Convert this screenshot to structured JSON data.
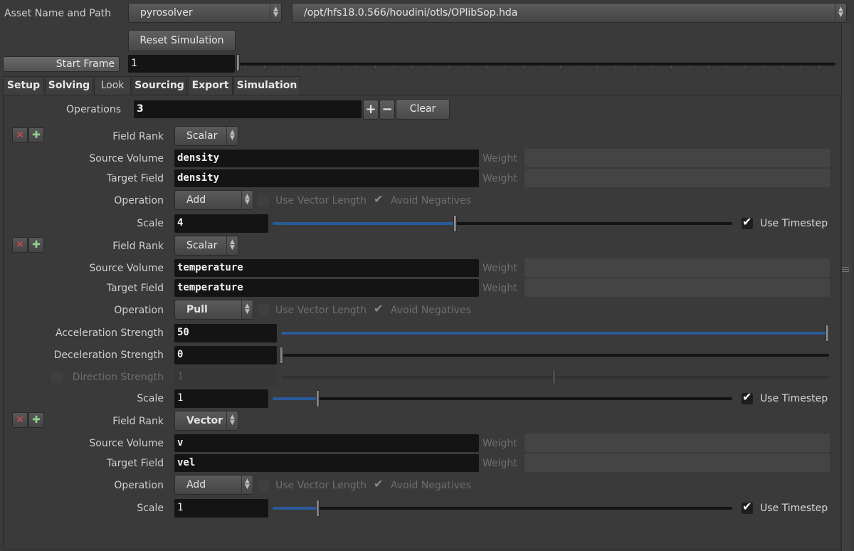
{
  "header": {
    "asset_label": "Asset Name and Path",
    "asset_name": "pyrosolver",
    "asset_path": "/opt/hfs18.0.566/houdini/otls/OPlibSop.hda",
    "reset_label": "Reset Simulation",
    "start_frame_label": "Start Frame",
    "start_frame_value": "1"
  },
  "tabs": [
    "Setup",
    "Solving",
    "Look",
    "Sourcing",
    "Export",
    "Simulation"
  ],
  "active_tab": "Sourcing",
  "operations": {
    "label": "Operations",
    "count": "3",
    "plus_label": "+",
    "minus_label": "−",
    "clear_label": "Clear"
  },
  "labels": {
    "field_rank": "Field Rank",
    "source_volume": "Source Volume",
    "target_field": "Target Field",
    "operation": "Operation",
    "scale": "Scale",
    "weight": "Weight",
    "use_vector_length": "Use Vector Length",
    "avoid_negatives": "Avoid Negatives",
    "use_timestep": "Use Timestep",
    "acceleration_strength": "Acceleration Strength",
    "deceleration_strength": "Deceleration Strength",
    "direction_strength": "Direction Strength"
  },
  "sources": [
    {
      "field_rank": "Scalar",
      "source_volume": "density",
      "target_field": "density",
      "operation": "Add",
      "scale": "4",
      "scale_fraction": 0.4,
      "use_vector_length": false,
      "avoid_negatives": true,
      "use_timestep": true
    },
    {
      "field_rank": "Scalar",
      "source_volume": "temperature",
      "target_field": "temperature",
      "operation": "Pull",
      "acceleration_strength": "50",
      "acceleration_fraction": 1.0,
      "deceleration_strength": "0",
      "deceleration_fraction": 0.0,
      "direction_strength": "1",
      "direction_fraction": 0.5,
      "scale": "1",
      "scale_fraction": 0.1,
      "use_vector_length": false,
      "avoid_negatives": true,
      "use_timestep": true
    },
    {
      "field_rank": "Vector",
      "source_volume": "v",
      "target_field": "vel",
      "operation": "Add",
      "scale": "1",
      "scale_fraction": 0.1,
      "use_vector_length": false,
      "avoid_negatives": true,
      "use_timestep": true
    }
  ],
  "icons": {
    "remove": "remove-x-icon",
    "insert": "insert-plus-icon",
    "combo_arrows": "up-down-arrows-icon",
    "checkmark": "checkmark-icon"
  },
  "colors": {
    "background": "#3a3a3a",
    "field": "#141414",
    "slider_fill": "#2a5a9a",
    "remove_icon": "#e04848",
    "insert_icon": "#8fd08f"
  }
}
